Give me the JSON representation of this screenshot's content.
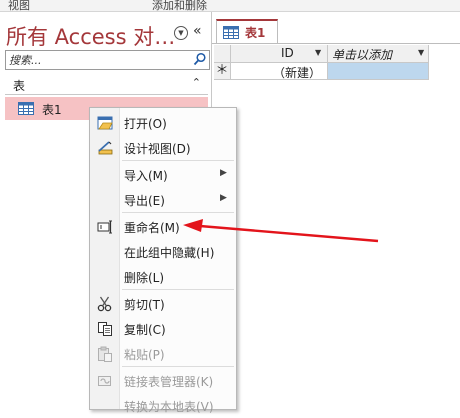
{
  "ribbon": {
    "group1": "视图",
    "group2": "添加和删除"
  },
  "nav": {
    "title": "所有 Access 对…",
    "search_placeholder": "搜索...",
    "group_label": "表",
    "item_label": "表1"
  },
  "tab": {
    "label": "表1"
  },
  "grid": {
    "columns": [
      "ID",
      "单击以添加"
    ],
    "new_row_marker": "＊",
    "new_row_value": "（新建）"
  },
  "context_menu": {
    "items": [
      {
        "label": "打开(O)",
        "icon": "open-icon",
        "enabled": true
      },
      {
        "label": "设计视图(D)",
        "icon": "design-view-icon",
        "enabled": true
      },
      {
        "label": "导入(M)",
        "submenu": true,
        "enabled": true
      },
      {
        "label": "导出(E)",
        "submenu": true,
        "enabled": true
      },
      {
        "label": "重命名(M)",
        "icon": "rename-icon",
        "enabled": true
      },
      {
        "label": "在此组中隐藏(H)",
        "enabled": true
      },
      {
        "label": "删除(L)",
        "enabled": true
      },
      {
        "label": "剪切(T)",
        "icon": "cut-icon",
        "enabled": true
      },
      {
        "label": "复制(C)",
        "icon": "copy-icon",
        "enabled": true
      },
      {
        "label": "粘贴(P)",
        "icon": "paste-icon",
        "enabled": false
      },
      {
        "label": "链接表管理器(K)",
        "icon": "linked-table-icon",
        "enabled": false
      },
      {
        "label": "转换为本地表(V)",
        "enabled": false
      }
    ]
  },
  "annotation": {
    "arrow_color": "#e3141b"
  },
  "colors": {
    "accent": "#a4373a",
    "selected_item": "#f6c2c4",
    "selected_cell": "#bdd7ee"
  }
}
